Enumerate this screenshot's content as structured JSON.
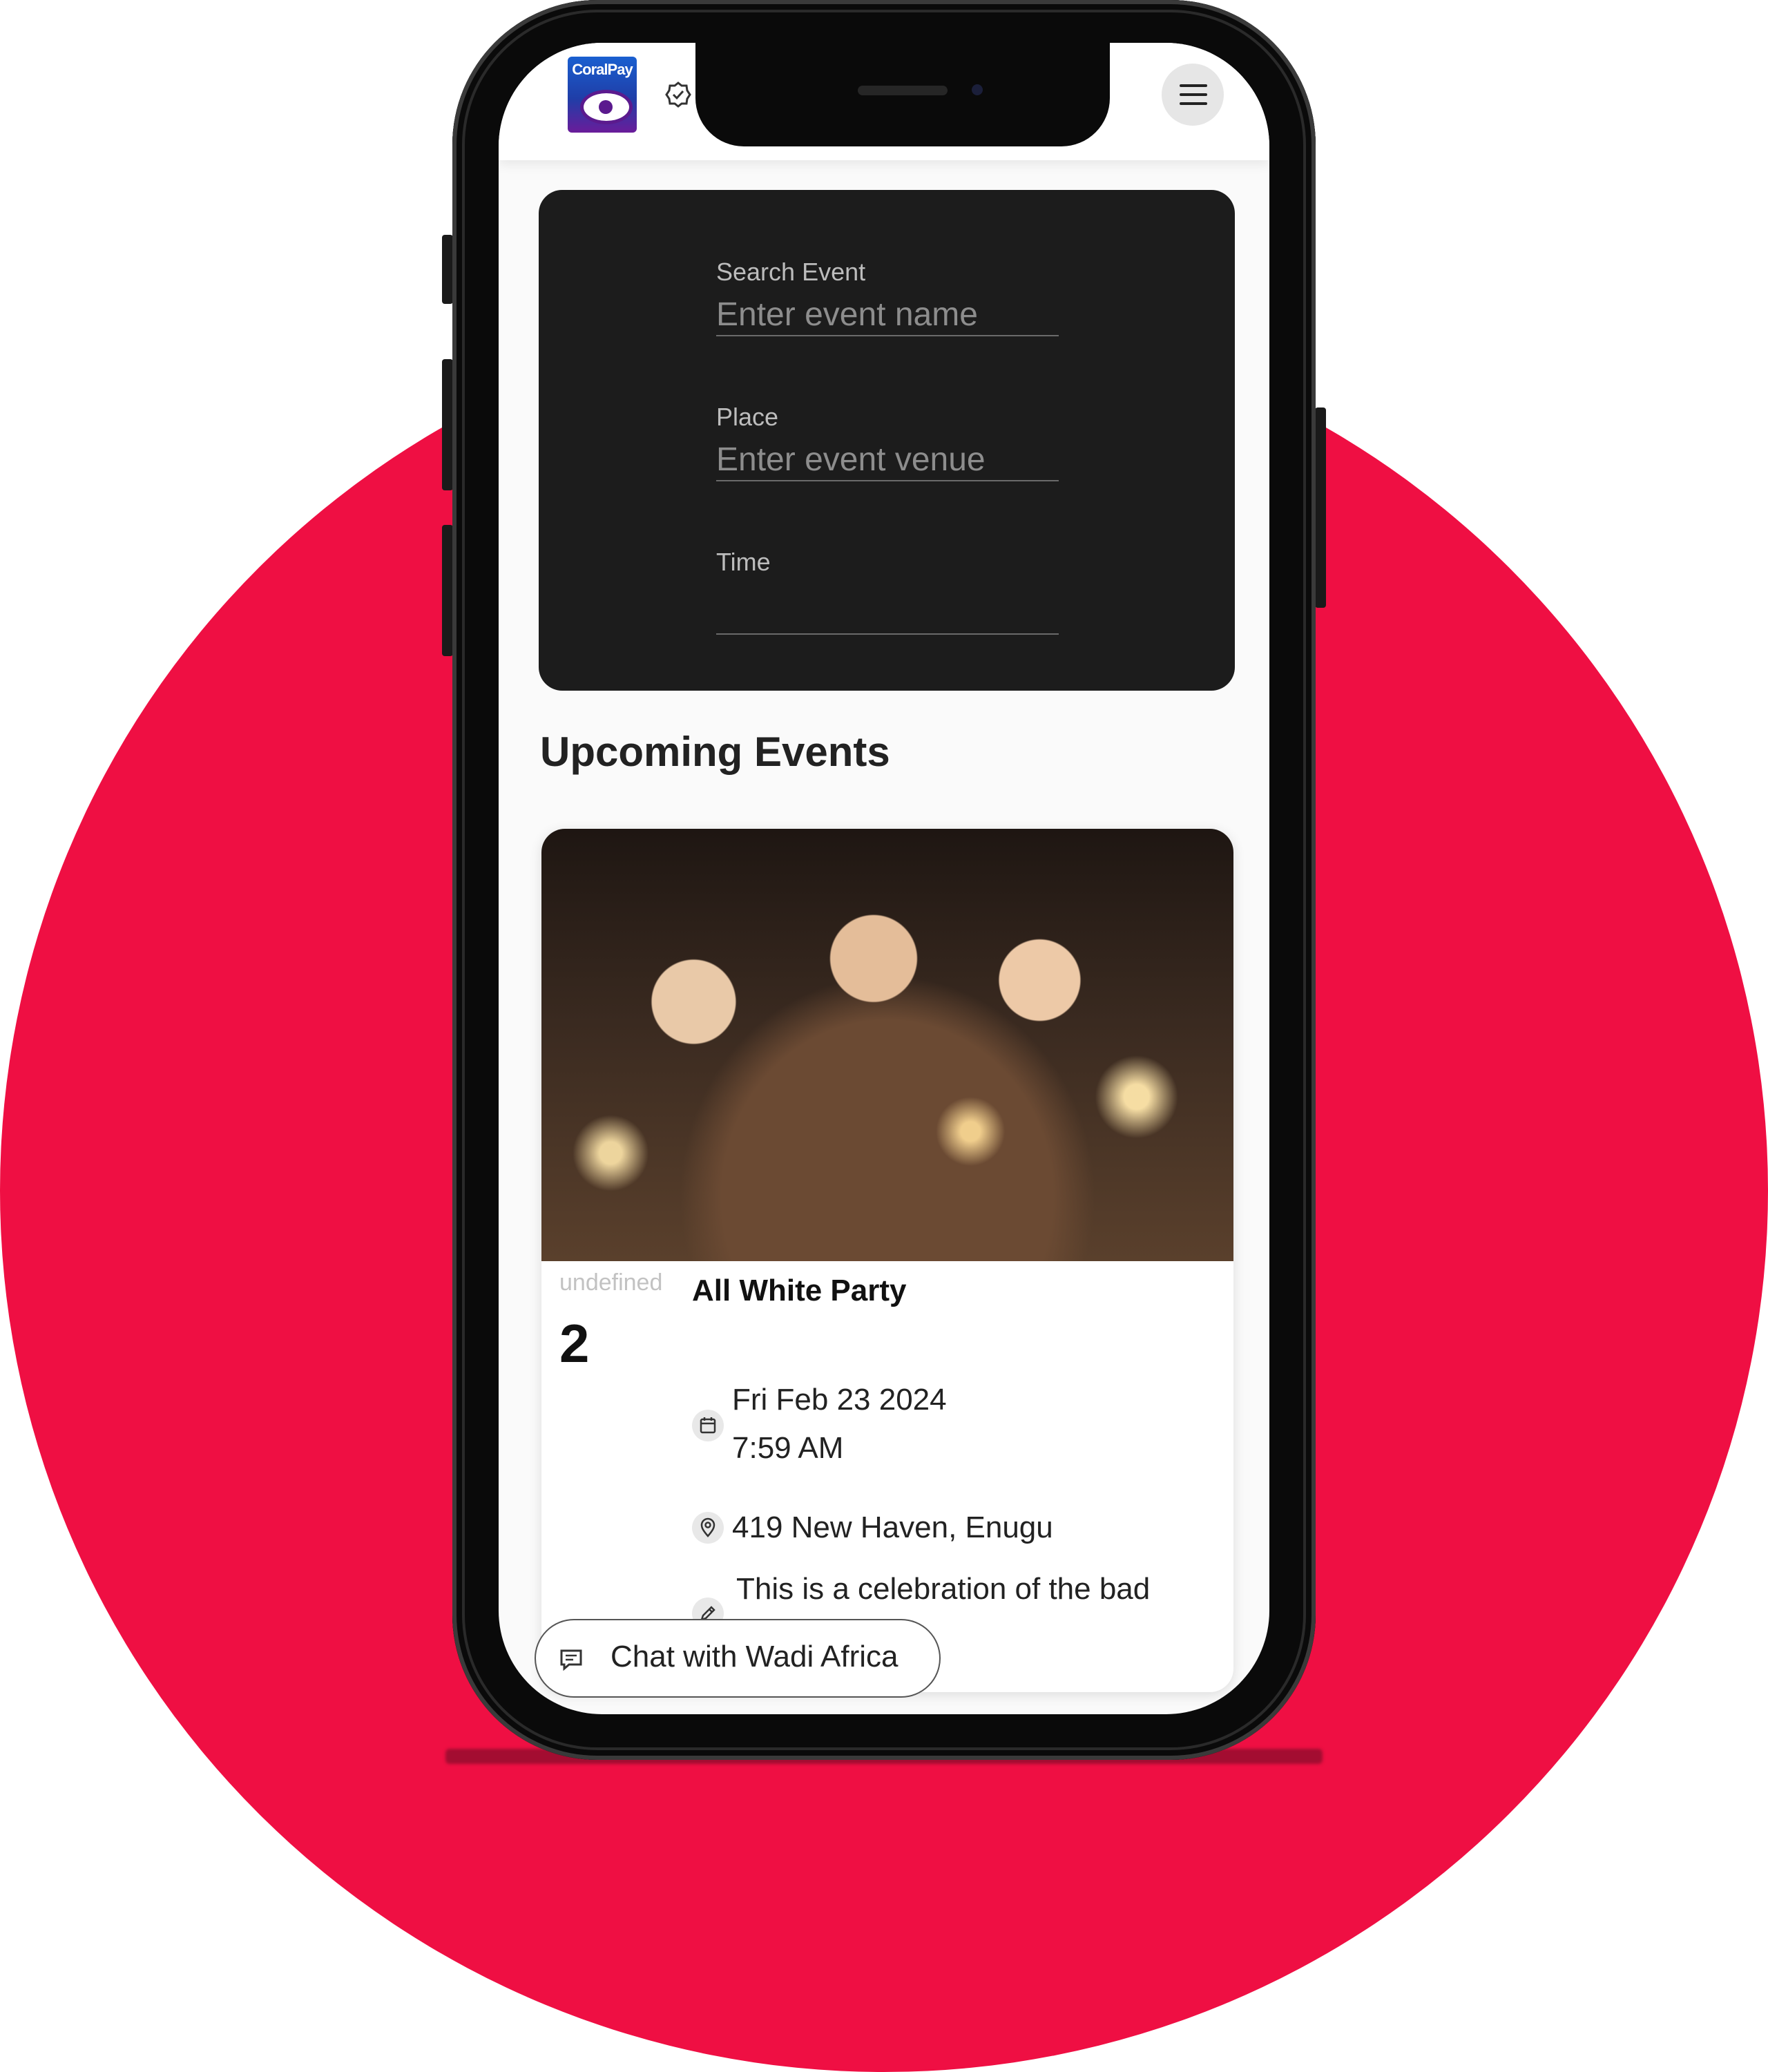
{
  "search": {
    "event_label": "Search Event",
    "event_placeholder": "Enter event name",
    "place_label": "Place",
    "place_placeholder": "Enter event venue",
    "time_label": "Time",
    "time_value": ""
  },
  "section": {
    "title": "Upcoming Events"
  },
  "event": {
    "date_sub": "undefined",
    "date_num": "2",
    "title": "All White Party",
    "date_line1": "Fri Feb 23 2024",
    "date_line2": "7:59 AM",
    "location": "419 New Haven, Enugu",
    "description": "This is a celebration of the bad economy"
  },
  "chat": {
    "label": "Chat with Wadi Africa"
  },
  "logo": {
    "text": "CoralPay"
  },
  "colors": {
    "accent": "#ef0f43",
    "card_dark": "#1c1c1c"
  }
}
